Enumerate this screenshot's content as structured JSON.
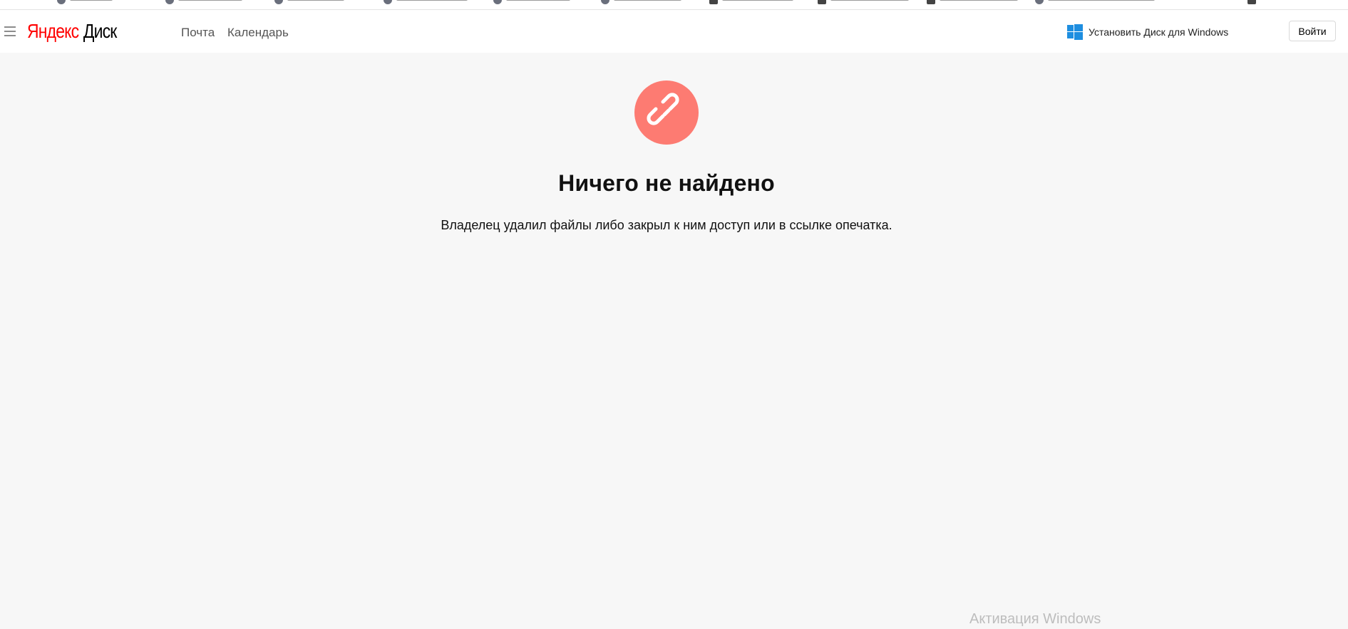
{
  "header": {
    "logo_brand": "Яндекс",
    "logo_product": "Диск",
    "nav": [
      {
        "label": "Почта"
      },
      {
        "label": "Календарь"
      }
    ],
    "install_label": "Установить Диск для Windows",
    "login_label": "Войти"
  },
  "main": {
    "title": "Ничего не найдено",
    "description": "Владелец удалил файлы либо закрыл к ним доступ или в ссылке опечатка.",
    "icon": "broken-link-icon"
  },
  "watermark": "Активация Windows",
  "colors": {
    "brand_red": "#ff0000",
    "error_circle": "#fd7b72",
    "windows_blue": "#1e8ee0",
    "background": "#f7f7f7"
  }
}
